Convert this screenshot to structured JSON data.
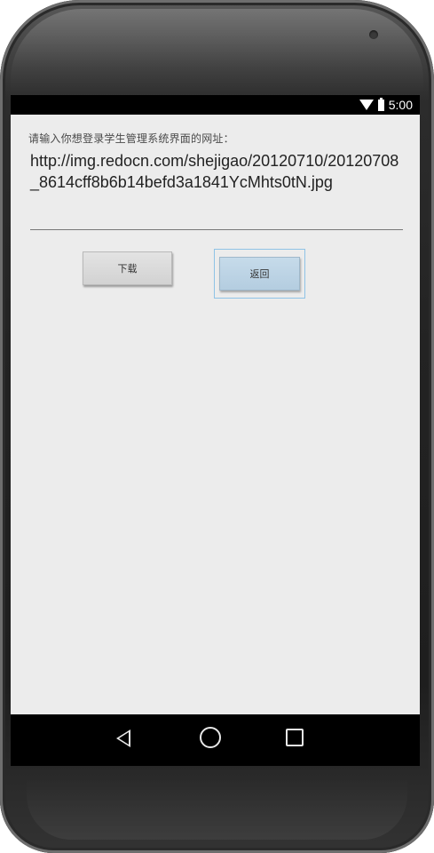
{
  "status_bar": {
    "time": "5:00",
    "wifi_icon": "wifi-icon",
    "battery_icon": "battery-icon"
  },
  "form": {
    "prompt": "请输入你想登录学生管理系统界面的网址：",
    "url_value": "http://img.redocn.com/shejigao/20120710/20120708_8614cff8b6b14befd3a1841YcMhts0tN.jpg"
  },
  "buttons": {
    "download_label": "下载",
    "back_label": "返回"
  },
  "nav_bar": {
    "back_icon": "back-triangle-icon",
    "home_icon": "home-circle-icon",
    "recent_icon": "recent-apps-square-icon"
  },
  "colors": {
    "screen_bg": "#ececec",
    "bar_bg": "#000000",
    "focus_border": "#8fc3e6",
    "back_button_bg": "#c6dbea"
  }
}
